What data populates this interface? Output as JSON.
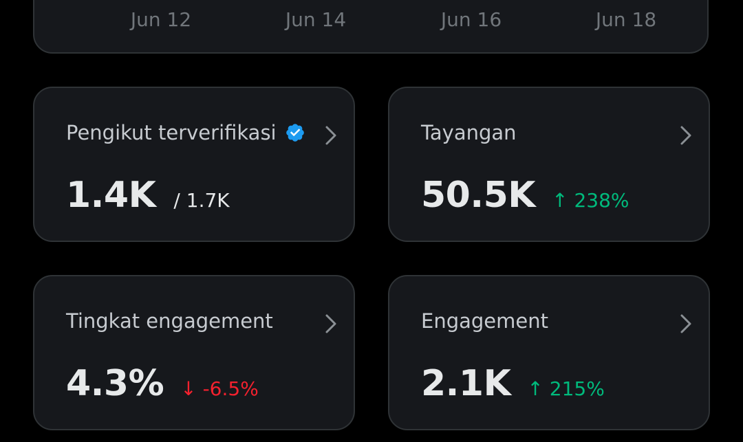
{
  "chart": {
    "x_ticks": [
      "Jun 12",
      "Jun 14",
      "Jun 16",
      "Jun 18"
    ]
  },
  "cards": [
    {
      "title": "Pengikut terverifikasi",
      "value": "1.4K",
      "sub_value": "/ 1.7K"
    },
    {
      "title": "Tayangan",
      "value": "50.5K",
      "change": "↑ 238%",
      "change_direction": "up"
    },
    {
      "title": "Tingkat engagement",
      "value": "4.3%",
      "change": "↓ -6.5%",
      "change_direction": "down"
    },
    {
      "title": "Engagement",
      "value": "2.1K",
      "change": "↑ 215%",
      "change_direction": "up"
    }
  ],
  "colors": {
    "background": "#000000",
    "card_background": "#16181c",
    "card_border": "#2f3336",
    "positive": "#00ba7c",
    "negative": "#f4212e",
    "verified": "#1d9bf0"
  }
}
